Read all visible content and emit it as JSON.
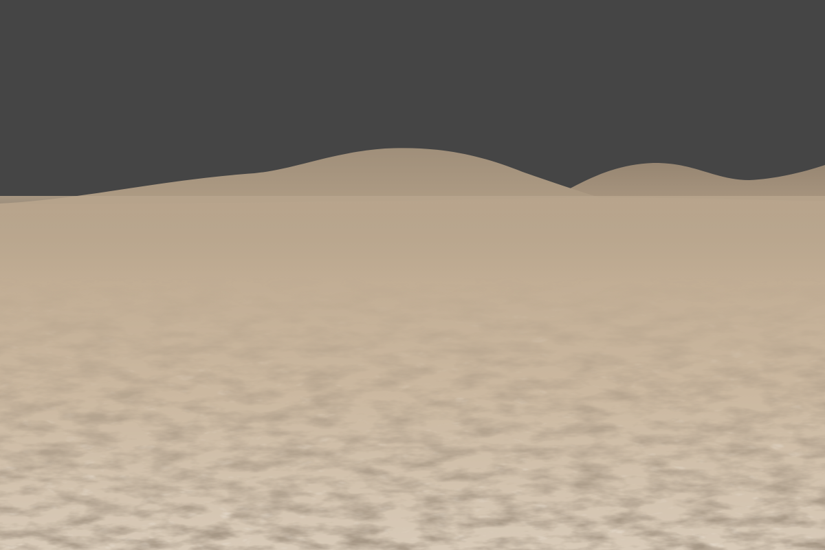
{
  "scene": {
    "type": "3d-terrain-viewport",
    "terrain": "cracked-dry-desert",
    "colors": {
      "sky": "#454545",
      "dune_far": "#9c8a75",
      "ground_far": "#b6a28a",
      "ground_mid": "#c8b49b",
      "ground_near": "#d6c7b3",
      "crack_dark": "#4a3b2c",
      "crack_light": "#ede4d8"
    }
  }
}
